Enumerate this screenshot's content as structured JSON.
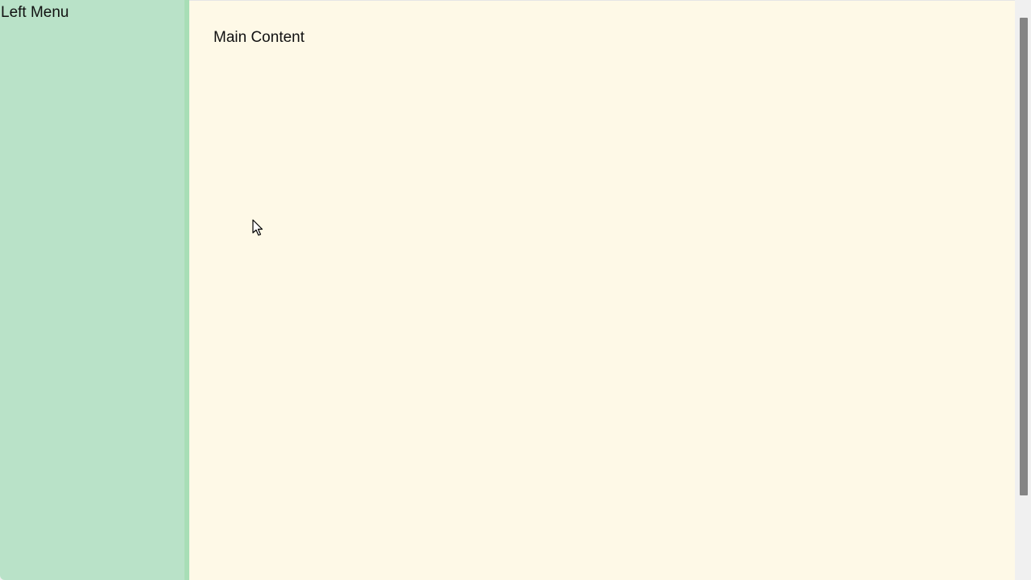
{
  "colors": {
    "left_menu_bg": "#b9e2c8",
    "splitter": "#a8deb6",
    "main_bg": "#fef9e7",
    "scrollbar_track": "#f0f0f0",
    "scrollbar_thumb": "#858585"
  },
  "left_menu": {
    "title": "Left Menu"
  },
  "main": {
    "title": "Main Content"
  },
  "scrollbar": {
    "thumb_fraction": 0.86
  },
  "icons": {
    "cursor": "mouse-pointer-icon"
  }
}
